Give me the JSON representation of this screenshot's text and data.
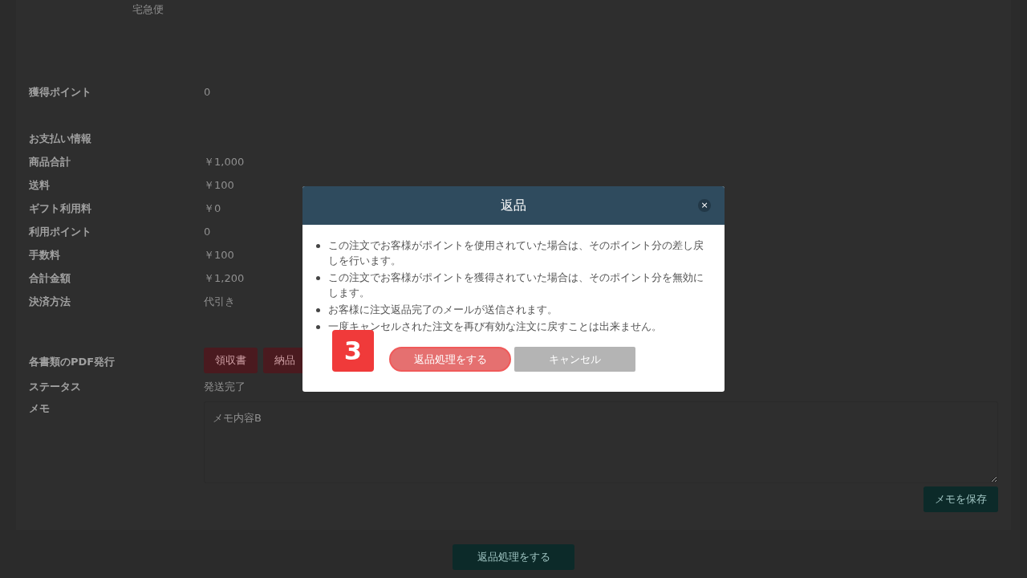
{
  "delivery_method": "宅急便",
  "earned_points": {
    "label": "獲得ポイント",
    "value": "0"
  },
  "payment": {
    "heading": "お支払い情報",
    "rows": [
      {
        "label": "商品合計",
        "value": "￥1,000"
      },
      {
        "label": "送料",
        "value": "￥100"
      },
      {
        "label": "ギフト利用料",
        "value": "￥0"
      },
      {
        "label": "利用ポイント",
        "value": "0"
      },
      {
        "label": "手数料",
        "value": "￥100"
      },
      {
        "label": "合計金額",
        "value": "￥1,200"
      },
      {
        "label": "決済方法",
        "value": "代引き"
      }
    ]
  },
  "pdf": {
    "label": "各書類のPDF発行",
    "buttons": [
      "領収書",
      "納品"
    ]
  },
  "status": {
    "label": "ステータス",
    "value": "発送完了"
  },
  "memo": {
    "label": "メモ",
    "value": "メモ内容B",
    "save_button": "メモを保存"
  },
  "return_button": "返品処理をする",
  "dialog": {
    "title": "返品",
    "close": "×",
    "notes": [
      "この注文でお客様がポイントを使用されていた場合は、そのポイント分の差し戻しを行います。",
      "この注文でお客様がポイントを獲得されていた場合は、そのポイント分を無効にします。",
      "お客様に注文返品完了のメールが送信されます。",
      "一度キャンセルされた注文を再び有効な注文に戻すことは出来ません。"
    ],
    "step_marker": "3",
    "confirm_button": "返品処理をする",
    "cancel_button": "キャンセル"
  }
}
